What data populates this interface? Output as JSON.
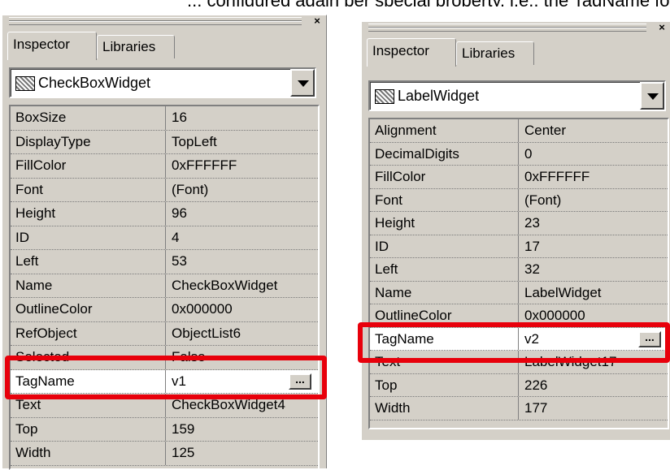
{
  "header_fragment": "... configured again per special property, i.e., the TagName for every widget ...",
  "panels": [
    {
      "tabs": [
        "Inspector",
        "Libraries"
      ],
      "widget_icon": "widget-icon",
      "widget_name": "CheckBoxWidget",
      "rows": [
        {
          "key": "BoxSize",
          "value": "16"
        },
        {
          "key": "DisplayType",
          "value": "TopLeft"
        },
        {
          "key": "FillColor",
          "value": "0xFFFFFF"
        },
        {
          "key": "Font",
          "value": "(Font)"
        },
        {
          "key": "Height",
          "value": "96"
        },
        {
          "key": "ID",
          "value": "4"
        },
        {
          "key": "Left",
          "value": "53"
        },
        {
          "key": "Name",
          "value": "CheckBoxWidget"
        },
        {
          "key": "OutlineColor",
          "value": "0x000000"
        },
        {
          "key": "RefObject",
          "value": "ObjectList6"
        },
        {
          "key": "Selected",
          "value": "False"
        },
        {
          "key": "TagName",
          "value": "v1"
        },
        {
          "key": "Text",
          "value": "CheckBoxWidget4"
        },
        {
          "key": "Top",
          "value": "159"
        },
        {
          "key": "Width",
          "value": "125"
        }
      ]
    },
    {
      "tabs": [
        "Inspector",
        "Libraries"
      ],
      "widget_icon": "widget-icon",
      "widget_name": "LabelWidget",
      "rows": [
        {
          "key": "Alignment",
          "value": "Center"
        },
        {
          "key": "DecimalDigits",
          "value": "0"
        },
        {
          "key": "FillColor",
          "value": "0xFFFFFF"
        },
        {
          "key": "Font",
          "value": "(Font)"
        },
        {
          "key": "Height",
          "value": "23"
        },
        {
          "key": "ID",
          "value": "17"
        },
        {
          "key": "Left",
          "value": "32"
        },
        {
          "key": "Name",
          "value": "LabelWidget"
        },
        {
          "key": "OutlineColor",
          "value": "0x000000"
        },
        {
          "key": "TagName",
          "value": "v2"
        },
        {
          "key": "Text",
          "value": "LabelWidget17"
        },
        {
          "key": "Top",
          "value": "226"
        },
        {
          "key": "Width",
          "value": "177"
        }
      ]
    }
  ],
  "ellipsis_label": "...",
  "close_glyph": "×",
  "highlight_color": "#e8000b"
}
